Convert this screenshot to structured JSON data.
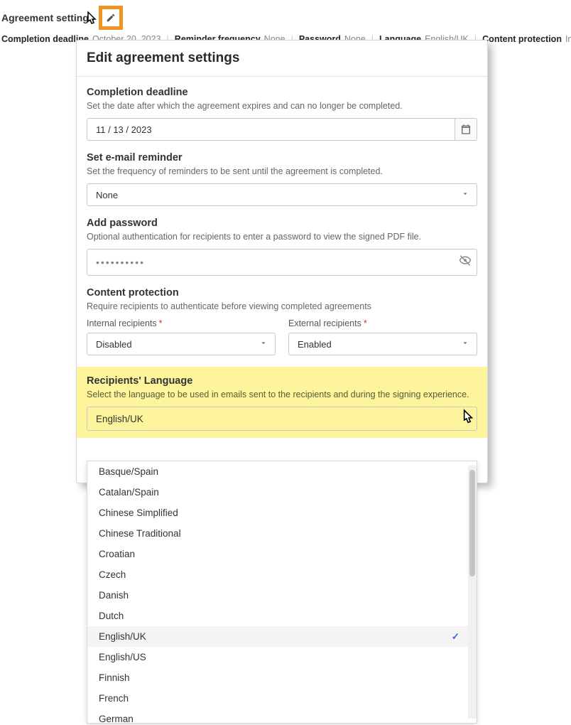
{
  "topbar": {
    "title": "Agreement settings",
    "summary": {
      "completion_deadline_label": "Completion deadline",
      "completion_deadline_value": "October 20, 2023",
      "reminder_label": "Reminder frequency",
      "reminder_value": "None",
      "password_label": "Password",
      "password_value": "None",
      "language_label": "Language",
      "language_value": "English/UK",
      "protection_label": "Content protection",
      "protection_value": "Internal disabled & External enabled"
    }
  },
  "dialog": {
    "title": "Edit agreement settings",
    "deadline": {
      "title": "Completion deadline",
      "desc": "Set the date after which the agreement expires and can no longer be completed.",
      "value": "11 /  13 /  2023"
    },
    "reminder": {
      "title": "Set e-mail reminder",
      "desc": "Set the frequency of reminders to be sent until the agreement is completed.",
      "value": "None"
    },
    "password": {
      "title": "Add password",
      "desc": "Optional authentication for recipients to enter a password to view the signed PDF file.",
      "value": "••••••••••"
    },
    "protection": {
      "title": "Content protection",
      "desc": "Require recipients to authenticate before viewing completed agreements",
      "internal_label": "Internal recipients",
      "internal_value": "Disabled",
      "external_label": "External recipients",
      "external_value": "Enabled"
    },
    "language": {
      "title": "Recipients' Language",
      "desc": "Select the language to be used in emails sent to the recipients and during the signing experience.",
      "value": "English/UK"
    }
  },
  "dropdown": {
    "options": [
      "Basque/Spain",
      "Catalan/Spain",
      "Chinese Simplified",
      "Chinese Traditional",
      "Croatian",
      "Czech",
      "Danish",
      "Dutch",
      "English/UK",
      "English/US",
      "Finnish",
      "French",
      "German"
    ],
    "selected": "English/UK"
  }
}
